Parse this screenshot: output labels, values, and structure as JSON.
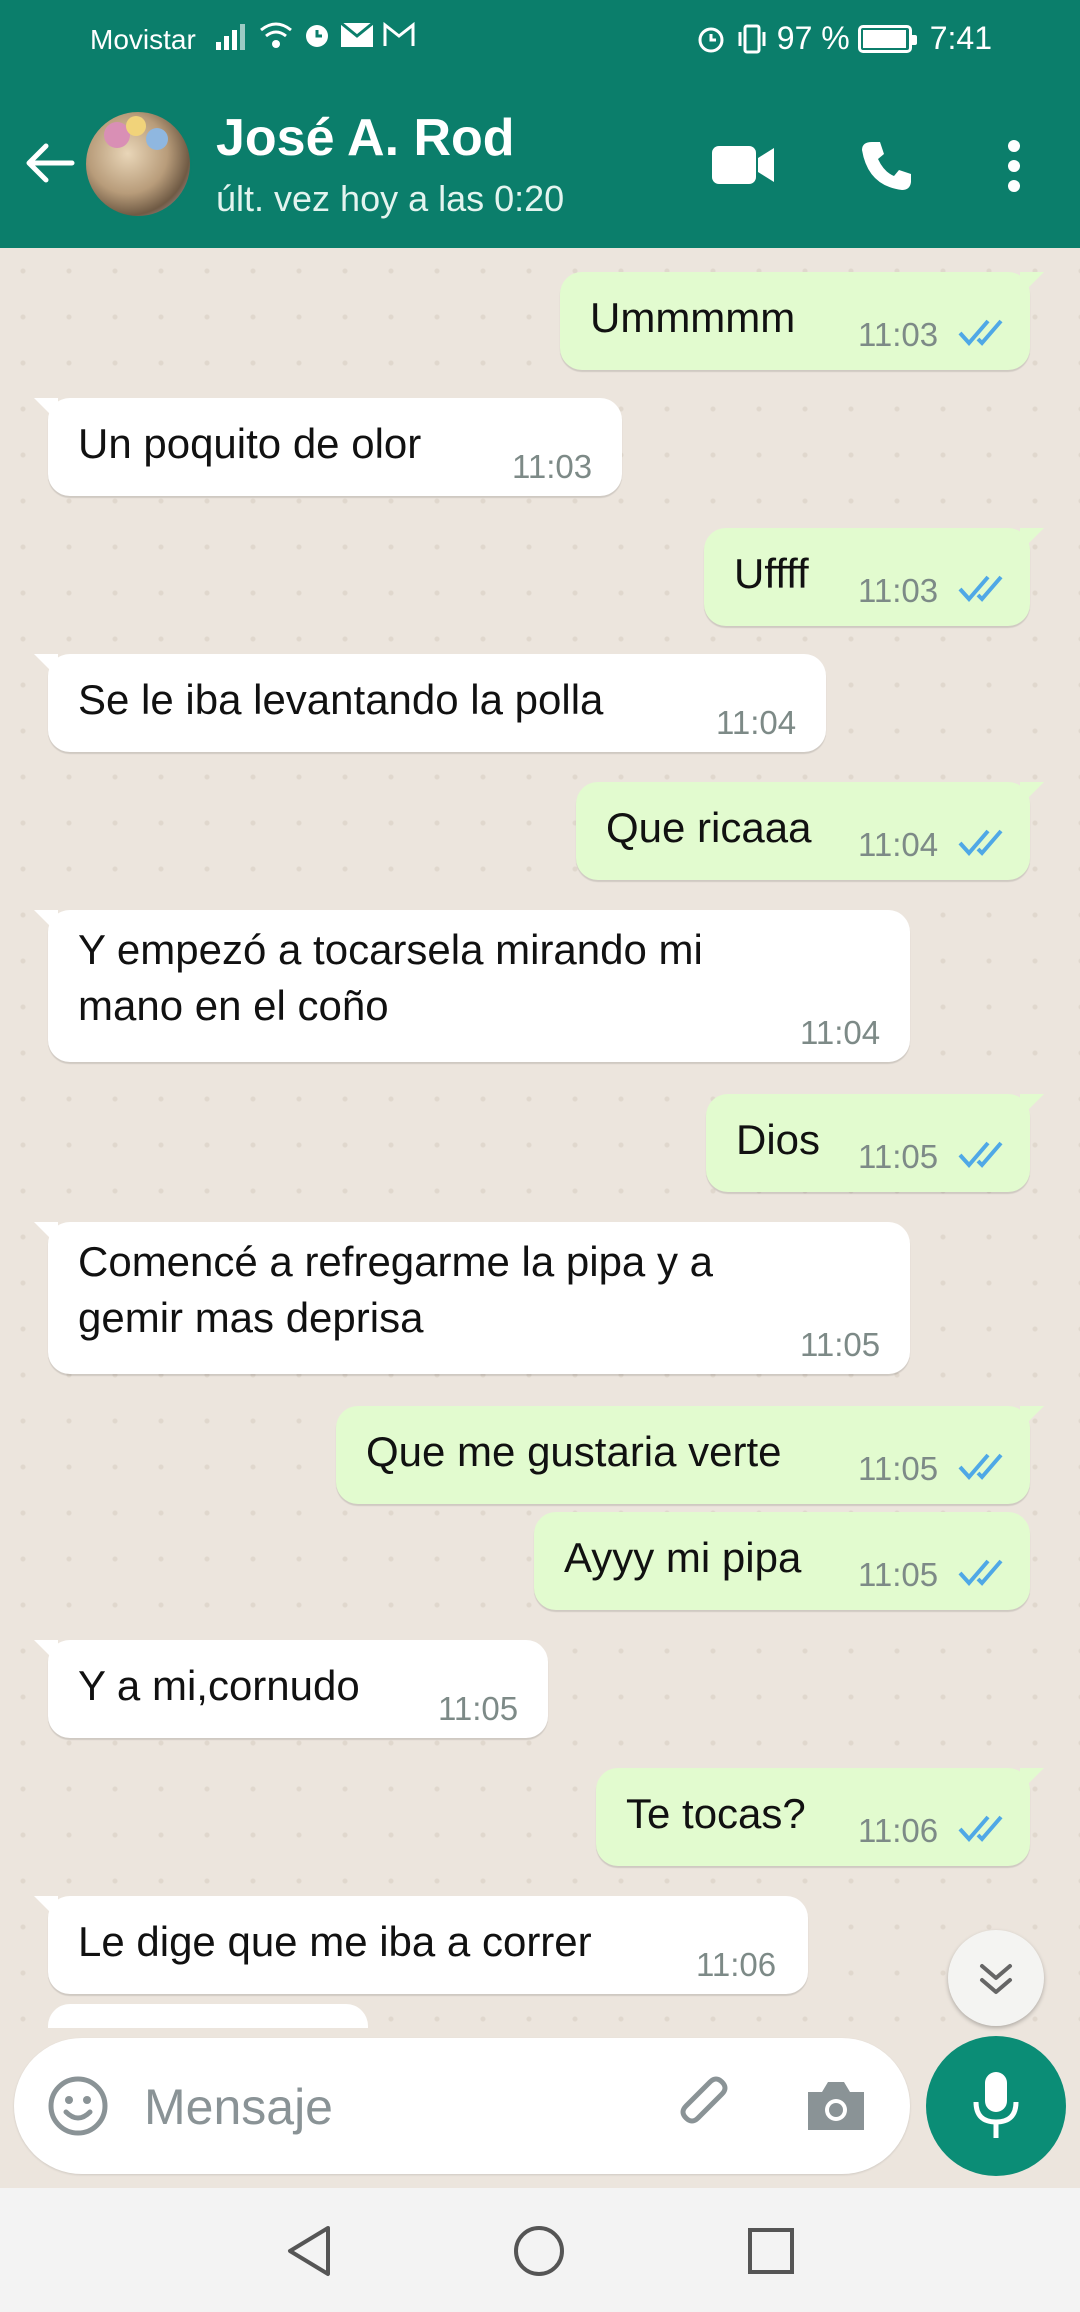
{
  "status_bar": {
    "carrier": "Movistar",
    "battery": "97 %",
    "battery_level": 0.97,
    "time": "7:41"
  },
  "header": {
    "contact_name": "José A. Rod",
    "last_seen": "últ. vez hoy a las 0:20"
  },
  "messages": [
    {
      "dir": "out",
      "text": "Ummmmm",
      "time": "11:03"
    },
    {
      "dir": "in",
      "text": "Un poquito de olor",
      "time": "11:03"
    },
    {
      "dir": "out",
      "text": "Uffff",
      "time": "11:03"
    },
    {
      "dir": "in",
      "text": "Se le iba levantando la polla",
      "time": "11:04"
    },
    {
      "dir": "out",
      "text": "Que ricaaa",
      "time": "11:04"
    },
    {
      "dir": "in",
      "lines": [
        "Y empezó a tocarsela mirando mi",
        "mano en el coño"
      ],
      "time": "11:04"
    },
    {
      "dir": "out",
      "text": "Dios",
      "time": "11:05"
    },
    {
      "dir": "in",
      "lines": [
        "Comencé a refregarme la pipa y a",
        "gemir mas deprisa"
      ],
      "time": "11:05"
    },
    {
      "dir": "out",
      "text": "Que me gustaria verte",
      "time": "11:05"
    },
    {
      "dir": "out",
      "text": "Ayyy mi pipa",
      "time": "11:05"
    },
    {
      "dir": "in",
      "text": "Y a mi,cornudo",
      "time": "11:05"
    },
    {
      "dir": "out",
      "text": "Te tocas?",
      "time": "11:06"
    },
    {
      "dir": "in",
      "text": "Le dige que me iba a correr",
      "time": "11:06"
    }
  ],
  "composer": {
    "placeholder": "Mensaje"
  },
  "colors": {
    "header": "#0b7e6b",
    "outgoing_bubble": "#e2fbcf",
    "incoming_bubble": "#ffffff",
    "read_ticks": "#4fa8e6",
    "mic_button": "#0b8d76"
  }
}
